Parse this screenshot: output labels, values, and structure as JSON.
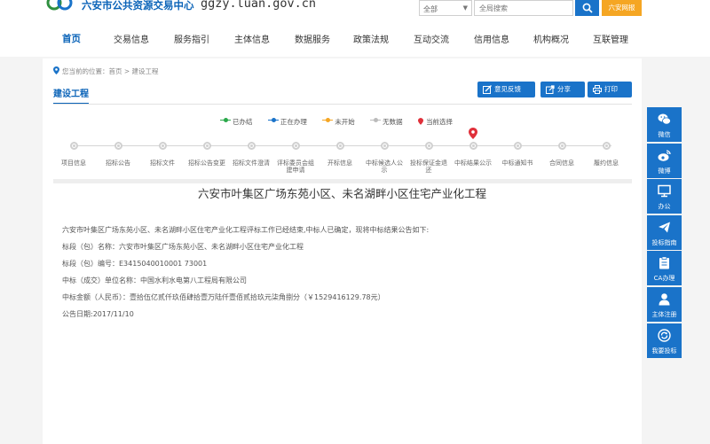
{
  "header": {
    "site_name": "六安市公共资源交易中心",
    "domain": "ggzy.luan.gov.cn",
    "search_scope": "全部",
    "search_placeholder": "全局搜索",
    "login_label": "六安网报"
  },
  "nav": {
    "items": [
      {
        "label": "首页",
        "active": true
      },
      {
        "label": "交易信息"
      },
      {
        "label": "服务指引"
      },
      {
        "label": "主体信息"
      },
      {
        "label": "数据服务"
      },
      {
        "label": "政策法规"
      },
      {
        "label": "互动交流"
      },
      {
        "label": "信用信息"
      },
      {
        "label": "机构概况"
      },
      {
        "label": "互联管理"
      }
    ]
  },
  "breadcrumb": "您当前的位置：首页 > 建设工程",
  "page_title": "建设工程",
  "actions": {
    "feedback": "意见反馈",
    "share": "分享",
    "print": "打印"
  },
  "legend": {
    "done": "已办结",
    "in_progress": "正在办理",
    "not_started": "未开始",
    "no_data": "无数据",
    "current": "当前选择"
  },
  "colors": {
    "primary": "#1a73c9",
    "done": "#2aa84a",
    "in_progress": "#1a73c9",
    "not_started": "#f5a623",
    "no_data": "#bbbbbb",
    "current": "#e0303a"
  },
  "steps": [
    {
      "label": "项目信息"
    },
    {
      "label": "招标公告"
    },
    {
      "label": "招标文件"
    },
    {
      "label": "招标公告变更"
    },
    {
      "label": "招标文件澄清"
    },
    {
      "label": "评标委员会组建申请"
    },
    {
      "label": "开标信息"
    },
    {
      "label": "中标候选人公示"
    },
    {
      "label": "投标保证金退还"
    },
    {
      "label": "中标结果公示",
      "current": true
    },
    {
      "label": "中标通知书"
    },
    {
      "label": "合同信息"
    },
    {
      "label": "履约信息"
    }
  ],
  "notice": {
    "title": "六安市叶集区广场东苑小区、未名湖畔小区住宅产业化工程",
    "lines": [
      "六安市叶集区广场东苑小区、未名湖畔小区住宅产业化工程评标工作已经结束,中标人已确定，现将中标结果公告如下:",
      "标段（包）名称：六安市叶集区广场东苑小区、未名湖畔小区住宅产业化工程",
      "标段（包）编号：E3415040010001 73001",
      "中标（成交）单位名称：中国水利水电第八工程局有限公司",
      "中标金额（人民币）：壹拾伍亿贰仟玖佰肆拾壹万陆仟壹佰贰拾玖元柒角捌分（￥1529416129.78元）",
      "公告日期:2017/11/10"
    ]
  },
  "sidebar": {
    "items": [
      {
        "label": "微信",
        "icon": "wechat-icon"
      },
      {
        "label": "微博",
        "icon": "weibo-icon"
      },
      {
        "label": "办公",
        "icon": "monitor-icon"
      },
      {
        "label": "投标指南",
        "icon": "paper-plane-icon"
      },
      {
        "label": "CA办理",
        "icon": "clipboard-icon"
      },
      {
        "label": "主体注册",
        "icon": "user-icon"
      },
      {
        "label": "我要投标",
        "icon": "refresh-icon"
      }
    ]
  }
}
